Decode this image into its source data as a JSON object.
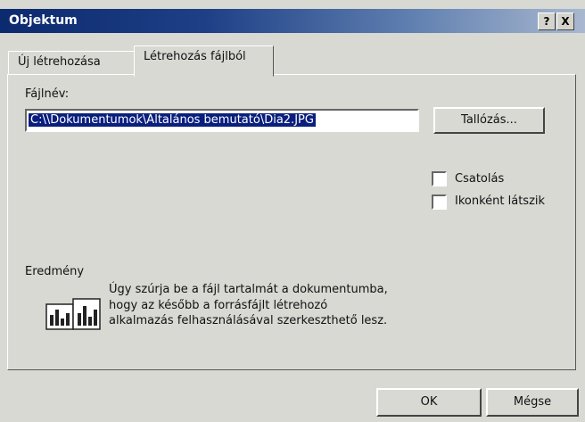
{
  "dialog": {
    "title": "Objektum",
    "help_button": "?",
    "close_button": "X"
  },
  "tabs": [
    {
      "label": "Új létrehozása",
      "active": false
    },
    {
      "label": "Létrehozás fájlból",
      "active": true
    }
  ],
  "file": {
    "label": "Fájlnév:",
    "value": "C:\\\\Dokumentumok\\Általános bemutató\\Dia2.JPG",
    "browse_button": "Tallózás..."
  },
  "options": [
    {
      "label": "Csatolás",
      "checked": false
    },
    {
      "label": "Ikonként látszik",
      "checked": false
    }
  ],
  "result": {
    "label": "Eredmény",
    "line1": "Úgy szúrja be a fájl tartalmát a dokumentumba,",
    "line2": "hogy az később a forrásfájlt létrehozó",
    "line3": "alkalmazás felhasználásával szerkeszthető lesz.",
    "icon": "embedded-object-icon"
  },
  "footer": {
    "ok": "OK",
    "cancel": "Mégse"
  }
}
